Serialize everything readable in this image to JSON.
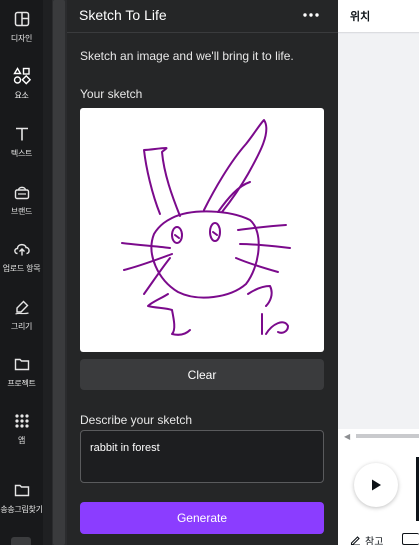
{
  "colors": {
    "rail_bg": "#18191b",
    "panel_bg": "#252627",
    "accent": "#8b3dff",
    "sketch_stroke": "#7b0a8c",
    "canvas_bg": "#ffffff"
  },
  "rail": {
    "items": [
      {
        "label": "디자인",
        "icon": "layout-icon"
      },
      {
        "label": "요소",
        "icon": "shapes-icon"
      },
      {
        "label": "텍스트",
        "icon": "text-icon"
      },
      {
        "label": "브랜드",
        "icon": "brand-icon"
      },
      {
        "label": "업로드 항목",
        "icon": "upload-icon"
      },
      {
        "label": "그리기",
        "icon": "draw-icon"
      },
      {
        "label": "프로젝트",
        "icon": "folder-icon"
      },
      {
        "label": "앱",
        "icon": "apps-grid-icon"
      },
      {
        "label": "송송그림찾기",
        "icon": "folder-icon"
      }
    ]
  },
  "panel": {
    "title": "Sketch To Life",
    "more_icon": "more-horizontal-icon",
    "description": "Sketch an image and we'll bring it to life.",
    "sketch_label": "Your sketch",
    "clear_label": "Clear",
    "describe_label": "Describe your sketch",
    "prompt_value": "rabbit in forest",
    "generate_label": "Generate"
  },
  "right": {
    "position_label": "위치",
    "notes_label": "참고",
    "play_icon": "play-icon"
  }
}
